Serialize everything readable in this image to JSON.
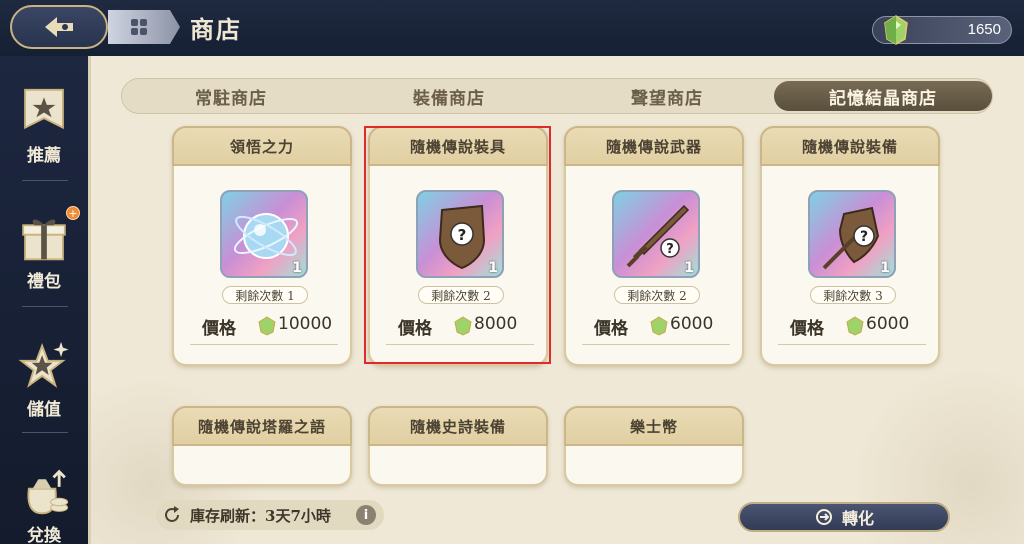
{
  "header": {
    "title": "商店",
    "currency_amount": "1650"
  },
  "sidebar": {
    "items": [
      {
        "label": "推薦",
        "icon": "star-banner-icon"
      },
      {
        "label": "禮包",
        "icon": "gift-box-icon",
        "badge": "+"
      },
      {
        "label": "儲值",
        "icon": "sparkle-star-icon"
      },
      {
        "label": "兌換",
        "icon": "coin-bag-icon"
      }
    ]
  },
  "tabs": [
    {
      "label": "常駐商店",
      "active": false
    },
    {
      "label": "裝備商店",
      "active": false
    },
    {
      "label": "聲望商店",
      "active": false
    },
    {
      "label": "記憶結晶商店",
      "active": true
    }
  ],
  "cards": [
    {
      "title": "領悟之力",
      "icon": "crystal-orb-icon",
      "quantity": "1",
      "remaining": "剩餘次數 1",
      "price_label": "價格",
      "price": "10000"
    },
    {
      "title": "隨機傳說裝具",
      "icon": "mystery-shield-icon",
      "quantity": "1",
      "remaining": "剩餘次數 2",
      "price_label": "價格",
      "price": "8000"
    },
    {
      "title": "隨機傳說武器",
      "icon": "mystery-sword-icon",
      "quantity": "1",
      "remaining": "剩餘次數 2",
      "price_label": "價格",
      "price": "6000"
    },
    {
      "title": "隨機傳說裝備",
      "icon": "mystery-gear-icon",
      "quantity": "1",
      "remaining": "剩餘次數 3",
      "price_label": "價格",
      "price": "6000"
    },
    {
      "title": "隨機傳說塔羅之語"
    },
    {
      "title": "隨機史詩裝備"
    },
    {
      "title": "樂士幣"
    }
  ],
  "footer": {
    "refresh_text": "庫存刷新：3天7小時",
    "info": "i",
    "convert_label": "轉化"
  },
  "colors": {
    "accent_active_tab": "#5a4f3d",
    "highlight": "#e02a2a",
    "card_bg": "#fbf8ef"
  }
}
